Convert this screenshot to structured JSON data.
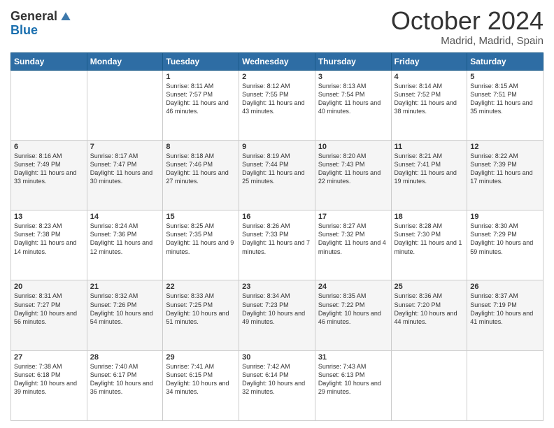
{
  "header": {
    "logo": {
      "general": "General",
      "blue": "Blue"
    },
    "title": "October 2024",
    "location": "Madrid, Madrid, Spain"
  },
  "calendar": {
    "weekdays": [
      "Sunday",
      "Monday",
      "Tuesday",
      "Wednesday",
      "Thursday",
      "Friday",
      "Saturday"
    ],
    "weeks": [
      [
        {
          "day": "",
          "content": ""
        },
        {
          "day": "",
          "content": ""
        },
        {
          "day": "1",
          "content": "Sunrise: 8:11 AM\nSunset: 7:57 PM\nDaylight: 11 hours and 46 minutes."
        },
        {
          "day": "2",
          "content": "Sunrise: 8:12 AM\nSunset: 7:55 PM\nDaylight: 11 hours and 43 minutes."
        },
        {
          "day": "3",
          "content": "Sunrise: 8:13 AM\nSunset: 7:54 PM\nDaylight: 11 hours and 40 minutes."
        },
        {
          "day": "4",
          "content": "Sunrise: 8:14 AM\nSunset: 7:52 PM\nDaylight: 11 hours and 38 minutes."
        },
        {
          "day": "5",
          "content": "Sunrise: 8:15 AM\nSunset: 7:51 PM\nDaylight: 11 hours and 35 minutes."
        }
      ],
      [
        {
          "day": "6",
          "content": "Sunrise: 8:16 AM\nSunset: 7:49 PM\nDaylight: 11 hours and 33 minutes."
        },
        {
          "day": "7",
          "content": "Sunrise: 8:17 AM\nSunset: 7:47 PM\nDaylight: 11 hours and 30 minutes."
        },
        {
          "day": "8",
          "content": "Sunrise: 8:18 AM\nSunset: 7:46 PM\nDaylight: 11 hours and 27 minutes."
        },
        {
          "day": "9",
          "content": "Sunrise: 8:19 AM\nSunset: 7:44 PM\nDaylight: 11 hours and 25 minutes."
        },
        {
          "day": "10",
          "content": "Sunrise: 8:20 AM\nSunset: 7:43 PM\nDaylight: 11 hours and 22 minutes."
        },
        {
          "day": "11",
          "content": "Sunrise: 8:21 AM\nSunset: 7:41 PM\nDaylight: 11 hours and 19 minutes."
        },
        {
          "day": "12",
          "content": "Sunrise: 8:22 AM\nSunset: 7:39 PM\nDaylight: 11 hours and 17 minutes."
        }
      ],
      [
        {
          "day": "13",
          "content": "Sunrise: 8:23 AM\nSunset: 7:38 PM\nDaylight: 11 hours and 14 minutes."
        },
        {
          "day": "14",
          "content": "Sunrise: 8:24 AM\nSunset: 7:36 PM\nDaylight: 11 hours and 12 minutes."
        },
        {
          "day": "15",
          "content": "Sunrise: 8:25 AM\nSunset: 7:35 PM\nDaylight: 11 hours and 9 minutes."
        },
        {
          "day": "16",
          "content": "Sunrise: 8:26 AM\nSunset: 7:33 PM\nDaylight: 11 hours and 7 minutes."
        },
        {
          "day": "17",
          "content": "Sunrise: 8:27 AM\nSunset: 7:32 PM\nDaylight: 11 hours and 4 minutes."
        },
        {
          "day": "18",
          "content": "Sunrise: 8:28 AM\nSunset: 7:30 PM\nDaylight: 11 hours and 1 minute."
        },
        {
          "day": "19",
          "content": "Sunrise: 8:30 AM\nSunset: 7:29 PM\nDaylight: 10 hours and 59 minutes."
        }
      ],
      [
        {
          "day": "20",
          "content": "Sunrise: 8:31 AM\nSunset: 7:27 PM\nDaylight: 10 hours and 56 minutes."
        },
        {
          "day": "21",
          "content": "Sunrise: 8:32 AM\nSunset: 7:26 PM\nDaylight: 10 hours and 54 minutes."
        },
        {
          "day": "22",
          "content": "Sunrise: 8:33 AM\nSunset: 7:25 PM\nDaylight: 10 hours and 51 minutes."
        },
        {
          "day": "23",
          "content": "Sunrise: 8:34 AM\nSunset: 7:23 PM\nDaylight: 10 hours and 49 minutes."
        },
        {
          "day": "24",
          "content": "Sunrise: 8:35 AM\nSunset: 7:22 PM\nDaylight: 10 hours and 46 minutes."
        },
        {
          "day": "25",
          "content": "Sunrise: 8:36 AM\nSunset: 7:20 PM\nDaylight: 10 hours and 44 minutes."
        },
        {
          "day": "26",
          "content": "Sunrise: 8:37 AM\nSunset: 7:19 PM\nDaylight: 10 hours and 41 minutes."
        }
      ],
      [
        {
          "day": "27",
          "content": "Sunrise: 7:38 AM\nSunset: 6:18 PM\nDaylight: 10 hours and 39 minutes."
        },
        {
          "day": "28",
          "content": "Sunrise: 7:40 AM\nSunset: 6:17 PM\nDaylight: 10 hours and 36 minutes."
        },
        {
          "day": "29",
          "content": "Sunrise: 7:41 AM\nSunset: 6:15 PM\nDaylight: 10 hours and 34 minutes."
        },
        {
          "day": "30",
          "content": "Sunrise: 7:42 AM\nSunset: 6:14 PM\nDaylight: 10 hours and 32 minutes."
        },
        {
          "day": "31",
          "content": "Sunrise: 7:43 AM\nSunset: 6:13 PM\nDaylight: 10 hours and 29 minutes."
        },
        {
          "day": "",
          "content": ""
        },
        {
          "day": "",
          "content": ""
        }
      ]
    ]
  }
}
